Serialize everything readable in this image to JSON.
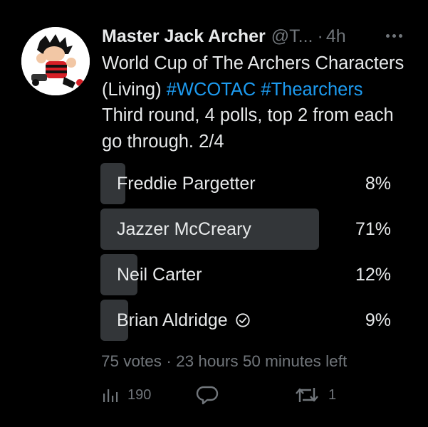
{
  "tweet": {
    "author_name": "Master Jack Archer",
    "author_handle": "@T...",
    "time_separator": "·",
    "time": "4h",
    "text_plain_1": "World Cup of The Archers Characters (Living) ",
    "hashtag_1": "#WCOTAC",
    "hashtag_2": "#Thearchers",
    "text_plain_2": " Third round, 4 polls, top 2 from each go through. 2/4"
  },
  "poll": {
    "options": [
      {
        "label": "Freddie Pargetter",
        "percent_text": "8%",
        "percent": 8
      },
      {
        "label": "Jazzer McCreary",
        "percent_text": "71%",
        "percent": 71
      },
      {
        "label": "Neil Carter",
        "percent_text": "12%",
        "percent": 12
      },
      {
        "label": "Brian Aldridge",
        "percent_text": "9%",
        "percent": 9,
        "selected": true
      }
    ],
    "votes": "75 votes",
    "separator": " · ",
    "time_left": "23 hours 50 minutes left"
  },
  "actions": {
    "views_icon": "bar-chart-icon",
    "views": "190",
    "reply_icon": "speech-bubble-icon",
    "retweet_icon": "retweet-icon",
    "retweets": "1"
  },
  "colors": {
    "background": "#000000",
    "text": "#e7e9ea",
    "muted": "#71767b",
    "hashtag": "#1d9bf0",
    "poll_bar": "#333639"
  }
}
